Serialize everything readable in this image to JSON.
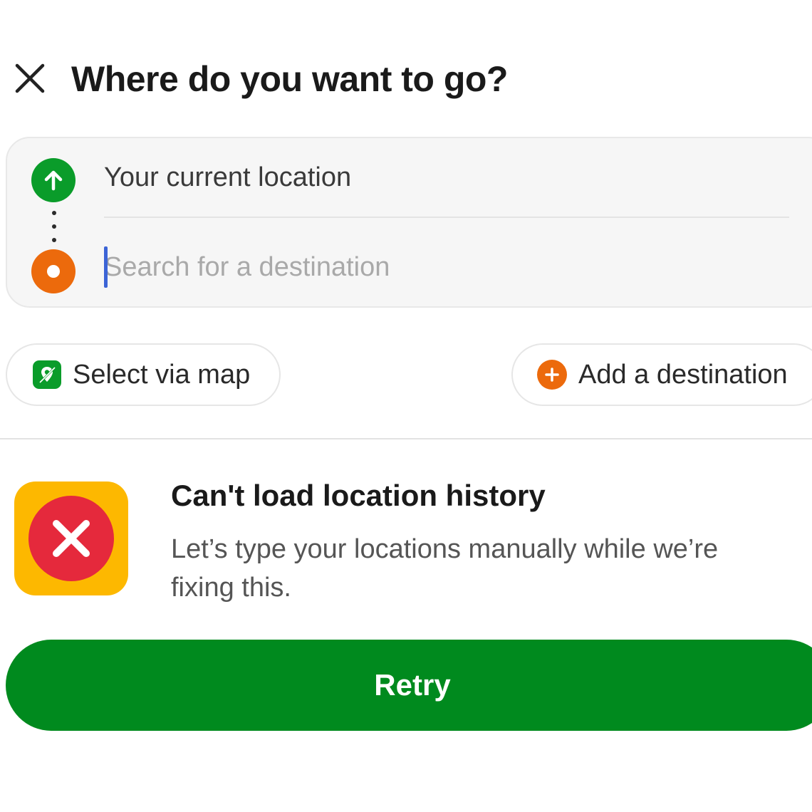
{
  "header": {
    "title": "Where do you want to go?",
    "close_icon": "close-icon"
  },
  "locations": {
    "origin": {
      "value": "Your current location",
      "icon": "arrow-up-circle-icon",
      "color": "#0a9c2a"
    },
    "destination": {
      "placeholder": "Search for a destination",
      "value": "",
      "icon": "destination-ring-icon",
      "color": "#ec6a0c"
    }
  },
  "chips": {
    "select_map": {
      "label": "Select via map",
      "icon": "map-pin-icon"
    },
    "add_destination": {
      "label": "Add a destination",
      "icon": "plus-circle-icon"
    }
  },
  "error": {
    "icon": "error-x-icon",
    "title": "Can't load location history",
    "message": "Let’s type your locations manually while we’re fixing this."
  },
  "retry": {
    "label": "Retry"
  },
  "colors": {
    "primary_green": "#008a1e",
    "accent_orange": "#ec6a0c",
    "warning_yellow": "#fdb800",
    "error_red": "#e5293c",
    "caret_blue": "#3c64d6"
  }
}
